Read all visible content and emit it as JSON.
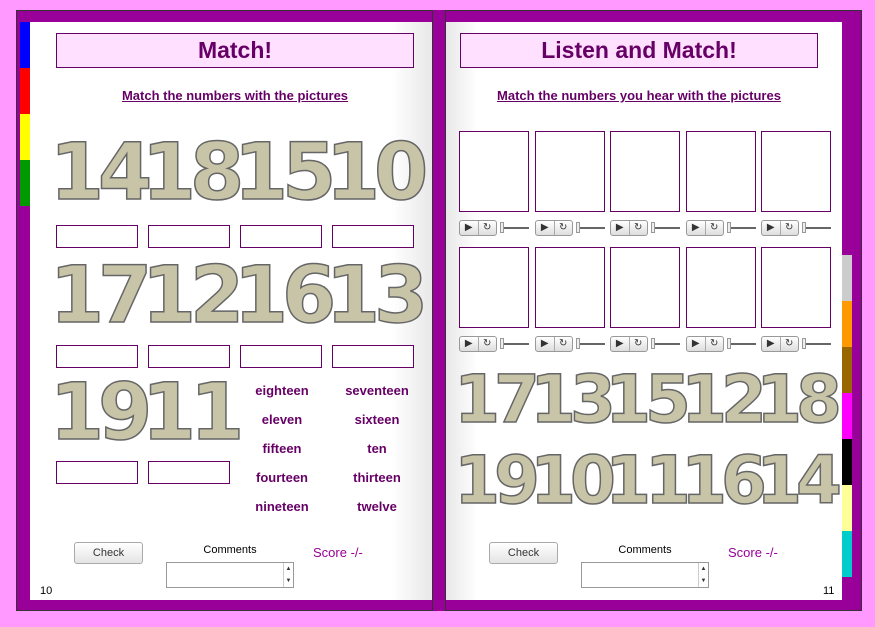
{
  "left_page": {
    "title": "Match!",
    "instruction": "Match the numbers with the pictures",
    "pictures": [
      "14",
      "18",
      "15",
      "10",
      "17",
      "12",
      "16",
      "13",
      "19",
      "11"
    ],
    "words": [
      "eighteen",
      "seventeen",
      "eleven",
      "sixteen",
      "fifteen",
      "ten",
      "fourteen",
      "thirteen",
      "nineteen",
      "twelve"
    ],
    "check_label": "Check",
    "comments_label": "Comments",
    "score": "Score -/-",
    "page_number": "10"
  },
  "right_page": {
    "title": "Listen and Match!",
    "instruction": "Match the numbers you hear with the pictures",
    "audio_controls": {
      "play": "▶",
      "replay": "↻"
    },
    "pictures": [
      "17",
      "13",
      "15",
      "12",
      "18",
      "19",
      "10",
      "11",
      "16",
      "14"
    ],
    "check_label": "Check",
    "comments_label": "Comments",
    "score": "Score -/-",
    "page_number": "11"
  },
  "tabs_left_colors": [
    "#0000ff",
    "#ff0000",
    "#ffff00",
    "#009900"
  ],
  "tabs_right_colors": [
    "#cccccc",
    "#ff9900",
    "#996600",
    "#ff00ff",
    "#000000",
    "#ffff99",
    "#00cccc"
  ],
  "frame_color": "#990099",
  "background_color": "#ff99ff"
}
